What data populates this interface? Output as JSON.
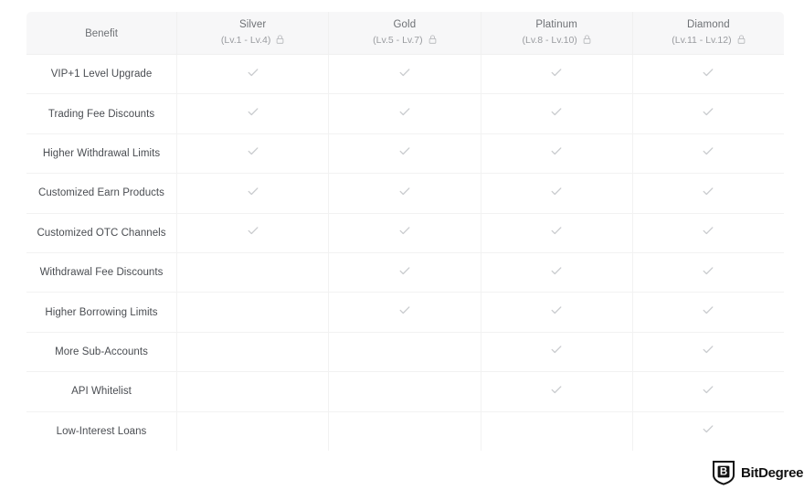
{
  "table": {
    "columns": [
      {
        "id": "benefit",
        "name": "Benefit",
        "sub": "",
        "locked": false
      },
      {
        "id": "silver",
        "name": "Silver",
        "sub": "(Lv.1 - Lv.4)",
        "locked": true
      },
      {
        "id": "gold",
        "name": "Gold",
        "sub": "(Lv.5 - Lv.7)",
        "locked": true
      },
      {
        "id": "platinum",
        "name": "Platinum",
        "sub": "(Lv.8 - Lv.10)",
        "locked": true
      },
      {
        "id": "diamond",
        "name": "Diamond",
        "sub": "(Lv.11 - Lv.12)",
        "locked": true
      }
    ],
    "lock_icon": "lock-icon",
    "check_icon": "check-icon",
    "rows": [
      {
        "benefit": "VIP+1 Level Upgrade",
        "silver": true,
        "gold": true,
        "platinum": true,
        "diamond": true
      },
      {
        "benefit": "Trading Fee Discounts",
        "silver": true,
        "gold": true,
        "platinum": true,
        "diamond": true
      },
      {
        "benefit": "Higher Withdrawal Limits",
        "silver": true,
        "gold": true,
        "platinum": true,
        "diamond": true
      },
      {
        "benefit": "Customized Earn Products",
        "silver": true,
        "gold": true,
        "platinum": true,
        "diamond": true
      },
      {
        "benefit": "Customized OTC Channels",
        "silver": true,
        "gold": true,
        "platinum": true,
        "diamond": true
      },
      {
        "benefit": "Withdrawal Fee Discounts",
        "silver": false,
        "gold": true,
        "platinum": true,
        "diamond": true
      },
      {
        "benefit": "Higher Borrowing Limits",
        "silver": false,
        "gold": true,
        "platinum": true,
        "diamond": true
      },
      {
        "benefit": "More Sub-Accounts",
        "silver": false,
        "gold": false,
        "platinum": true,
        "diamond": true
      },
      {
        "benefit": "API Whitelist",
        "silver": false,
        "gold": false,
        "platinum": true,
        "diamond": true
      },
      {
        "benefit": "Low-Interest Loans",
        "silver": false,
        "gold": false,
        "platinum": false,
        "diamond": true
      }
    ]
  },
  "branding": {
    "name": "BitDegree",
    "badge_letter": "B",
    "badge_icon": "shield-badge-icon"
  },
  "colors": {
    "header_bg": "#f7f7f8",
    "header_text": "#6e7175",
    "header_sub_text": "#9a9ca0",
    "body_text": "#4a4d52",
    "border": "#f2f2f2",
    "check": "#c9cbce",
    "page_bg": "#ffffff",
    "logo": "#111111"
  }
}
